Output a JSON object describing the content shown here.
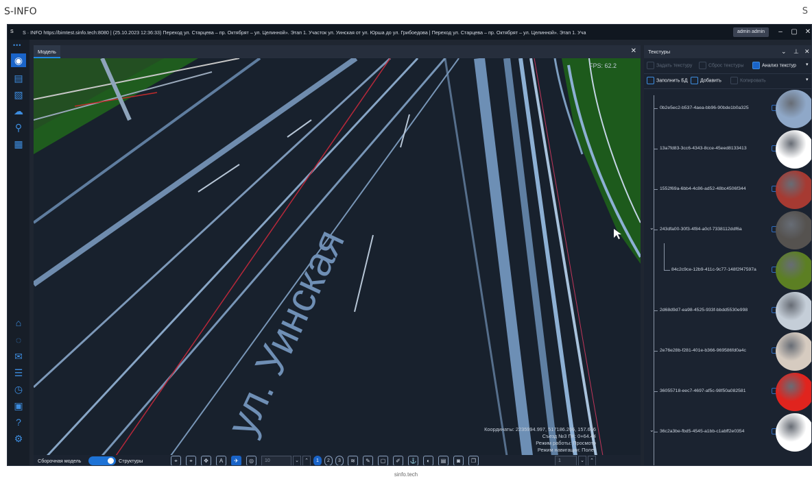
{
  "outer": {
    "title": "S-INFO",
    "corner": "S",
    "footer": "sinfo.tech"
  },
  "titlebar": {
    "logo": "S",
    "text": "S · INFO  https://bimtest.sinfo.tech:8080 | (25.10.2023 12:36:33) Переход ул. Старцева – пр. Октябрят – ул. Целинной». Этап 1. Участок ул. Уинская от ул. Юрша до ул. Грибоедова | Переход ул. Старцева – пр. Октябрят – ул. Целинной». Этап 1. Уча",
    "user": "admin admin"
  },
  "model": {
    "tab_label": "Модель",
    "fps": "FPS: 62.2",
    "street_label": "ул. Уинская",
    "info": {
      "coords": "Координаты:  2235994.997, 517186.266, 157.606",
      "ramp": "Съезд №3 ПК:  0+64.44",
      "mode": "Режим работы: Просмотр",
      "nav": "Режим навигации: Полет"
    }
  },
  "toolbar": {
    "assembly_label": "Сборочная модель",
    "structure_label": "Структуры",
    "level_value": "10",
    "page_value": "1",
    "levels": [
      "1",
      "2",
      "3"
    ]
  },
  "panel": {
    "title": "Текстуры",
    "row1": {
      "set": "Задать текстуру",
      "reset": "Сброс текстуры",
      "analyze": "Анализ текстур"
    },
    "row2": {
      "fill": "Заполнить БД",
      "add": "Добавить",
      "copy": "Копировать"
    },
    "textures": [
      {
        "id": "0b2e5ec2-b537-4aea-bb96-90bde1b0a325",
        "color": "#8fa8c8",
        "expanded": false,
        "child": false
      },
      {
        "id": "13a7fd83-3cc6-4343-8cce-45eed8133413",
        "color": "#ffffff",
        "expanded": false,
        "child": false
      },
      {
        "id": "1552f69a-6bb4-4c86-ad52-48bc4506f344",
        "color": "#a63a32",
        "expanded": false,
        "child": false
      },
      {
        "id": "243dfa00-30f3-4f84-a0cf-7338112ddf6a",
        "color": "#55524f",
        "expanded": true,
        "child": false
      },
      {
        "id": "84c2c9ce-12b9-411c-9c77-148f2f47597a",
        "color": "#5c7f23",
        "expanded": false,
        "child": true
      },
      {
        "id": "2d68d9d7-ea98-4525-933f-bbdd5530e998",
        "color": "#c5ced8",
        "expanded": false,
        "child": false
      },
      {
        "id": "2e76e28b-f281-401e-b366-969586fd0a4c",
        "color": "#d6cbc0",
        "expanded": false,
        "child": false
      },
      {
        "id": "36055718-eec7-4697-af5c-98f50a082581",
        "color": "#e0241e",
        "expanded": false,
        "child": false
      },
      {
        "id": "36c2a3be-fbd5-4545-a1bb-c1abff2e0354",
        "color": "#ffffff",
        "expanded": true,
        "child": false
      }
    ]
  },
  "colors": {
    "accent": "#1a64c8",
    "bg": "#1f2631",
    "road": "#18212d"
  }
}
